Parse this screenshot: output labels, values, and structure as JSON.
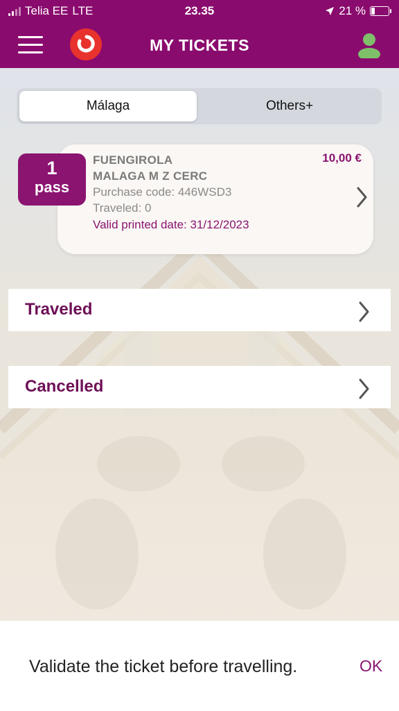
{
  "status_bar": {
    "carrier": "Telia EE",
    "network": "LTE",
    "time": "23.35",
    "battery_percent": "21 %",
    "battery_level": 0.21,
    "icons": [
      "signal-icon",
      "location-arrow-icon",
      "battery-icon"
    ]
  },
  "header": {
    "title": "MY TICKETS",
    "menu_icon": "hamburger-menu-icon",
    "logo_icon": "renfe-logo-icon",
    "profile_icon": "user-profile-icon"
  },
  "tabs": [
    {
      "label": "Málaga",
      "selected": true
    },
    {
      "label": "Others+",
      "selected": false
    }
  ],
  "ticket": {
    "count": "1",
    "count_label": "pass",
    "origin": "FUENGIROLA",
    "destination": "MALAGA M Z CERC",
    "purchase_code": "Purchase code: 446WSD3",
    "traveled": "Traveled: 0",
    "valid_date": "Valid printed date: 31/12/2023",
    "price": "10,00 €"
  },
  "sections": [
    {
      "label": "Traveled"
    },
    {
      "label": "Cancelled"
    }
  ],
  "snackbar": {
    "message": "Validate the ticket before travelling.",
    "action": "OK"
  },
  "colors": {
    "brand_purple": "#8a0b6e",
    "accent_purple": "#8a1470",
    "logo_red": "#e8322d"
  }
}
